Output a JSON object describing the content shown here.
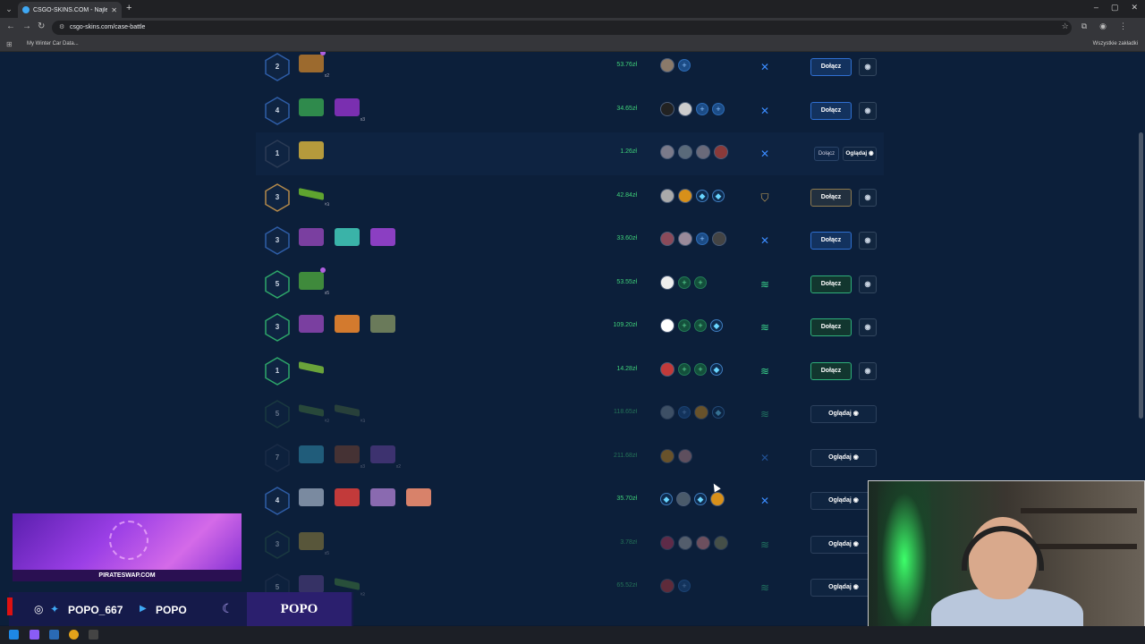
{
  "browser": {
    "tab_title": "CSGO-SKINS.COM - Najlep",
    "url": "csgo-skins.com/case-battle",
    "bookmark": "My Winter Car Data...",
    "bookmarks_folder": "Wszystkie zakładki"
  },
  "battles": [
    {
      "rounds": "2",
      "price": "53.76zł",
      "join": "Dołącz",
      "watch": ""
    },
    {
      "rounds": "4",
      "price": "34.65zł",
      "join": "Dołącz",
      "watch": ""
    },
    {
      "rounds": "1",
      "price": "1.26zł",
      "join": "Dołącz",
      "watch": "Oglądaj"
    },
    {
      "rounds": "3",
      "price": "42.84zł",
      "join": "Dołącz",
      "watch": ""
    },
    {
      "rounds": "3",
      "price": "33.60zł",
      "join": "Dołącz",
      "watch": ""
    },
    {
      "rounds": "5",
      "price": "53.55zł",
      "join": "Dołącz",
      "watch": ""
    },
    {
      "rounds": "3",
      "price": "109.20zł",
      "join": "Dołącz",
      "watch": ""
    },
    {
      "rounds": "1",
      "price": "14.28zł",
      "join": "Dołącz",
      "watch": ""
    },
    {
      "rounds": "5",
      "price": "118.65zł",
      "join": "",
      "watch": "Oglądaj"
    },
    {
      "rounds": "7",
      "price": "211.68zł",
      "join": "",
      "watch": "Oglądaj"
    },
    {
      "rounds": "4",
      "price": "35.70zł",
      "join": "",
      "watch": "Oglądaj"
    },
    {
      "rounds": "3",
      "price": "3.78zł",
      "join": "",
      "watch": "Oglądaj"
    },
    {
      "rounds": "5",
      "price": "65.52zł",
      "join": "",
      "watch": "Oglądaj"
    }
  ],
  "overlay": {
    "promo_label": "PIRATESWAP.COM",
    "handle": "POPO_667",
    "youtube": "POPO",
    "name": "POPO"
  },
  "colors": {
    "background": "#0c1f3a",
    "price": "#3fd27a",
    "join_blue": "#2f6fd1",
    "join_green": "#2fb07a"
  }
}
